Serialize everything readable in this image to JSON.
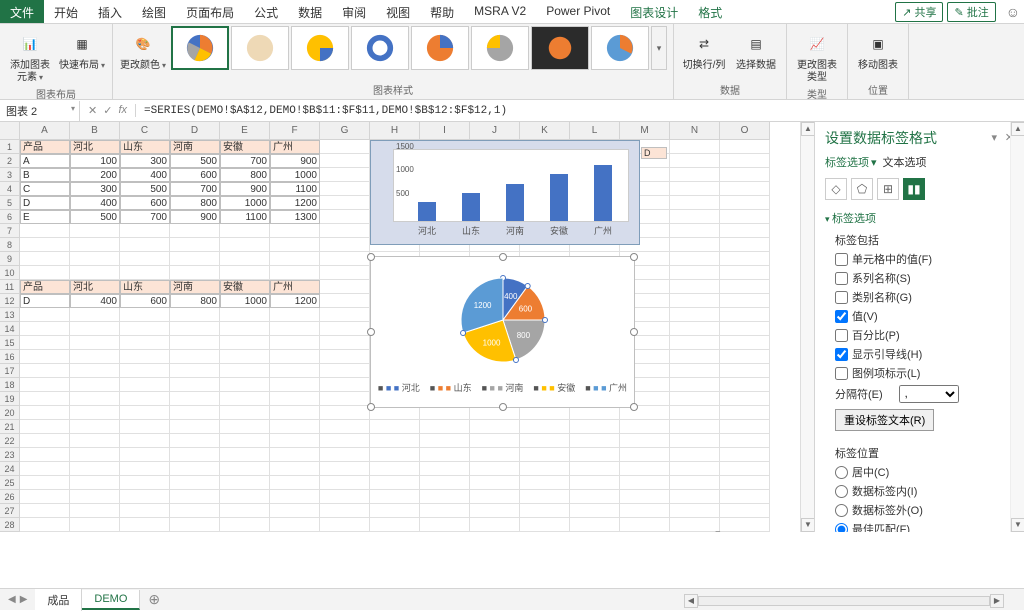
{
  "tabs": {
    "file": "文件",
    "start": "开始",
    "insert": "插入",
    "draw": "绘图",
    "layout": "页面布局",
    "formula": "公式",
    "data": "数据",
    "review": "审阅",
    "view": "视图",
    "help": "帮助",
    "msra": "MSRA V2",
    "pivot": "Power Pivot",
    "chartdesign": "图表设计",
    "format": "格式"
  },
  "share": "共享",
  "annotate": "批注",
  "ribbon": {
    "addElement": "添加图表元素",
    "quickLayout": "快速布局",
    "changeColor": "更改颜色",
    "groupLayout": "图表布局",
    "groupStyles": "图表样式",
    "groupData": "数据",
    "groupType": "类型",
    "groupPos": "位置",
    "swapRowCol": "切换行/列",
    "selectData": "选择数据",
    "changeType": "更改图表类型",
    "moveChart": "移动图表"
  },
  "namebox": "图表 2",
  "formula": "=SERIES(DEMO!$A$12,DEMO!$B$11:$F$11,DEMO!$B$12:$F$12,1)",
  "cols": [
    "A",
    "B",
    "C",
    "D",
    "E",
    "F",
    "G",
    "H",
    "I",
    "J",
    "K",
    "L",
    "M",
    "N",
    "O"
  ],
  "table1": {
    "headers": [
      "产品",
      "河北",
      "山东",
      "河南",
      "安徽",
      "广州"
    ],
    "rows": [
      [
        "A",
        "100",
        "300",
        "500",
        "700",
        "900"
      ],
      [
        "B",
        "200",
        "400",
        "600",
        "800",
        "1000"
      ],
      [
        "C",
        "300",
        "500",
        "700",
        "900",
        "1100"
      ],
      [
        "D",
        "400",
        "600",
        "800",
        "1000",
        "1200"
      ],
      [
        "E",
        "500",
        "700",
        "900",
        "1100",
        "1300"
      ]
    ]
  },
  "table2": {
    "headers": [
      "产品",
      "河北",
      "山东",
      "河南",
      "安徽",
      "广州"
    ],
    "rows": [
      [
        "D",
        "400",
        "600",
        "800",
        "1000",
        "1200"
      ]
    ]
  },
  "chart_data": [
    {
      "type": "bar",
      "categories": [
        "河北",
        "山东",
        "河南",
        "安徽",
        "广州"
      ],
      "values": [
        400,
        600,
        800,
        1000,
        1200
      ],
      "ylim": [
        0,
        1500
      ],
      "yticks": [
        500,
        1000,
        1500
      ]
    },
    {
      "type": "pie",
      "categories": [
        "河北",
        "山东",
        "河南",
        "安徽",
        "广州"
      ],
      "values": [
        400,
        600,
        800,
        1000,
        1200
      ],
      "colors": [
        "#4472c4",
        "#ed7d31",
        "#a5a5a5",
        "#ffc000",
        "#5b9bd5"
      ]
    }
  ],
  "barDLabel": "D",
  "taskpane": {
    "title": "设置数据标签格式",
    "tabLabel": "标签选项",
    "tabText": "文本选项",
    "sectionLabel": "标签选项",
    "includes": "标签包括",
    "optCellVal": "单元格中的值(F)",
    "optSeries": "系列名称(S)",
    "optCategory": "类别名称(G)",
    "optValue": "值(V)",
    "optPercent": "百分比(P)",
    "optLeader": "显示引导线(H)",
    "optLegendKey": "图例项标示(L)",
    "separator": "分隔符(E)",
    "separatorVal": ",",
    "resetBtn": "重设标签文本(R)",
    "posLabel": "标签位置",
    "posCenter": "居中(C)",
    "posInside": "数据标签内(I)",
    "posOutside": "数据标签外(O)",
    "posBest": "最佳匹配(F)"
  },
  "sheetTabs": {
    "finished": "成品",
    "demo": "DEMO"
  }
}
